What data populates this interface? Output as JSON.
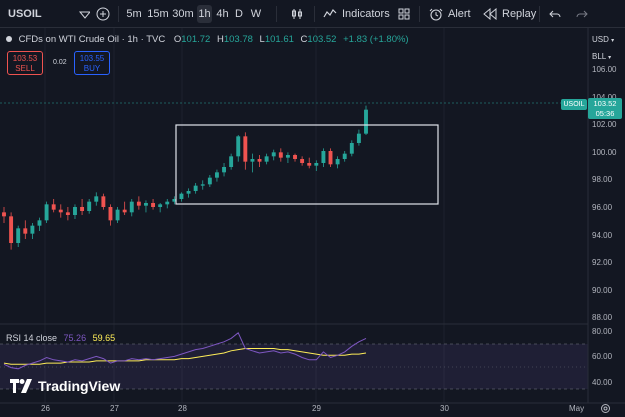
{
  "toolbar": {
    "symbol": "USOIL",
    "intervals": [
      {
        "label": "5m",
        "active": false
      },
      {
        "label": "15m",
        "active": false
      },
      {
        "label": "30m",
        "active": false
      },
      {
        "label": "1h",
        "active": true
      },
      {
        "label": "4h",
        "active": false
      },
      {
        "label": "D",
        "active": false
      },
      {
        "label": "W",
        "active": false
      }
    ],
    "indicators_label": "Indicators",
    "alert_label": "Alert",
    "replay_label": "Replay"
  },
  "legend": {
    "title": "CFDs on WTI Crude Oil · 1h · TVC",
    "open_label": "O",
    "open": "101.72",
    "high_label": "H",
    "high": "103.78",
    "low_label": "L",
    "low": "101.61",
    "close_label": "C",
    "close": "103.52",
    "change": "+1.83 (+1.80%)"
  },
  "trade": {
    "sell_price": "103.53",
    "sell_label": "SELL",
    "spread": "0.02",
    "buy_price": "103.55",
    "buy_label": "BUY"
  },
  "scale": {
    "currency": "USD",
    "unit": "BLL",
    "price_labels": [
      "106.00",
      "104.00",
      "102.00",
      "100.00",
      "98.00",
      "96.00",
      "94.00",
      "92.00",
      "90.00",
      "88.00"
    ],
    "rsi_labels": [
      "80.00",
      "60.00",
      "40.00"
    ],
    "last_price": "103.52",
    "countdown": "05:36",
    "symbol_tag": "USOIL"
  },
  "time_axis": {
    "labels": [
      "26",
      "27",
      "28",
      "29",
      "30",
      "May"
    ]
  },
  "rsi": {
    "label": "RSI 14 close",
    "value1": "75.26",
    "value2": "59.65"
  },
  "branding": {
    "logo_text": "TradingView"
  },
  "colors": {
    "up": "#26a69a",
    "down": "#ef5350",
    "rsi_line": "#7e57c2",
    "rsi_ma": "#ffee58",
    "background": "#131722"
  },
  "chart_data": {
    "type": "candlestick",
    "x": [
      "26",
      "27",
      "28",
      "29",
      "30",
      "May"
    ],
    "ylim": [
      87,
      107
    ],
    "candles": [
      [
        95.8,
        96.2,
        95.0,
        95.5
      ],
      [
        95.5,
        95.8,
        93.0,
        93.5
      ],
      [
        93.5,
        94.8,
        93.2,
        94.6
      ],
      [
        94.6,
        95.2,
        93.8,
        94.2
      ],
      [
        94.2,
        95.0,
        93.8,
        94.8
      ],
      [
        94.8,
        95.4,
        94.4,
        95.2
      ],
      [
        95.2,
        96.6,
        95.0,
        96.4
      ],
      [
        96.4,
        96.8,
        95.8,
        96.0
      ],
      [
        96.0,
        96.4,
        95.4,
        95.8
      ],
      [
        95.8,
        96.2,
        95.2,
        95.6
      ],
      [
        95.6,
        96.4,
        95.3,
        96.2
      ],
      [
        96.2,
        96.8,
        95.6,
        95.9
      ],
      [
        95.9,
        96.8,
        95.7,
        96.6
      ],
      [
        96.6,
        97.3,
        96.3,
        97.0
      ],
      [
        97.0,
        97.2,
        96.0,
        96.2
      ],
      [
        96.2,
        96.4,
        94.8,
        95.2
      ],
      [
        95.2,
        96.2,
        95.0,
        96.0
      ],
      [
        96.0,
        96.6,
        95.6,
        95.8
      ],
      [
        95.8,
        96.8,
        95.5,
        96.6
      ],
      [
        96.6,
        97.0,
        96.0,
        96.3
      ],
      [
        96.3,
        96.7,
        95.8,
        96.5
      ],
      [
        96.5,
        96.8,
        96.0,
        96.2
      ],
      [
        96.2,
        96.5,
        95.8,
        96.4
      ],
      [
        96.4,
        96.8,
        96.1,
        96.6
      ],
      [
        96.6,
        97.0,
        96.4,
        96.8
      ],
      [
        96.8,
        97.3,
        96.6,
        97.2
      ],
      [
        97.2,
        97.6,
        96.9,
        97.4
      ],
      [
        97.4,
        98.0,
        97.2,
        97.8
      ],
      [
        97.8,
        98.2,
        97.5,
        97.9
      ],
      [
        97.9,
        98.6,
        97.7,
        98.4
      ],
      [
        98.4,
        99.0,
        98.1,
        98.8
      ],
      [
        98.8,
        99.5,
        98.5,
        99.2
      ],
      [
        99.2,
        100.2,
        99.0,
        100.0
      ],
      [
        100.0,
        101.6,
        99.6,
        101.5
      ],
      [
        101.5,
        101.8,
        99.0,
        99.6
      ],
      [
        99.6,
        100.2,
        98.8,
        99.8
      ],
      [
        99.8,
        100.1,
        99.2,
        99.6
      ],
      [
        99.6,
        100.2,
        99.4,
        100.0
      ],
      [
        100.0,
        100.5,
        99.7,
        100.3
      ],
      [
        100.3,
        100.6,
        99.6,
        99.9
      ],
      [
        99.9,
        100.3,
        99.5,
        100.1
      ],
      [
        100.1,
        100.2,
        99.6,
        99.8
      ],
      [
        99.8,
        100.0,
        99.3,
        99.5
      ],
      [
        99.5,
        99.9,
        99.1,
        99.3
      ],
      [
        99.3,
        99.7,
        98.9,
        99.5
      ],
      [
        99.5,
        100.6,
        99.2,
        100.4
      ],
      [
        100.4,
        100.6,
        99.2,
        99.4
      ],
      [
        99.4,
        100.0,
        99.1,
        99.8
      ],
      [
        99.8,
        100.4,
        99.6,
        100.2
      ],
      [
        100.2,
        101.2,
        100.0,
        101.0
      ],
      [
        101.0,
        102.0,
        100.8,
        101.7
      ],
      [
        101.7,
        103.8,
        101.6,
        103.5
      ]
    ],
    "rsi": [
      52,
      49,
      48,
      51,
      53,
      55,
      58,
      56,
      55,
      54,
      56,
      55,
      57,
      59,
      57,
      53,
      55,
      55,
      57,
      56,
      57,
      56,
      57,
      58,
      59,
      61,
      63,
      65,
      66,
      68,
      70,
      72,
      75,
      80,
      66,
      64,
      62,
      63,
      64,
      62,
      63,
      61,
      58,
      56,
      56,
      63,
      58,
      60,
      63,
      68,
      72,
      75
    ],
    "rsi_ma": [
      53,
      52,
      52,
      52,
      52,
      52,
      53,
      53,
      53,
      54,
      54,
      54,
      54,
      55,
      55,
      55,
      55,
      55,
      55,
      55,
      56,
      56,
      56,
      56,
      56,
      57,
      57,
      58,
      59,
      60,
      61,
      62,
      64,
      65,
      66,
      66,
      66,
      66,
      66,
      65,
      65,
      64,
      63,
      62,
      61,
      60,
      60,
      60,
      60,
      61,
      61,
      62
    ],
    "rsi_ylim": [
      30,
      85
    ],
    "rsi_levels": [
      70,
      30
    ],
    "rsi_midline": 50,
    "annotation": "rectangle"
  }
}
